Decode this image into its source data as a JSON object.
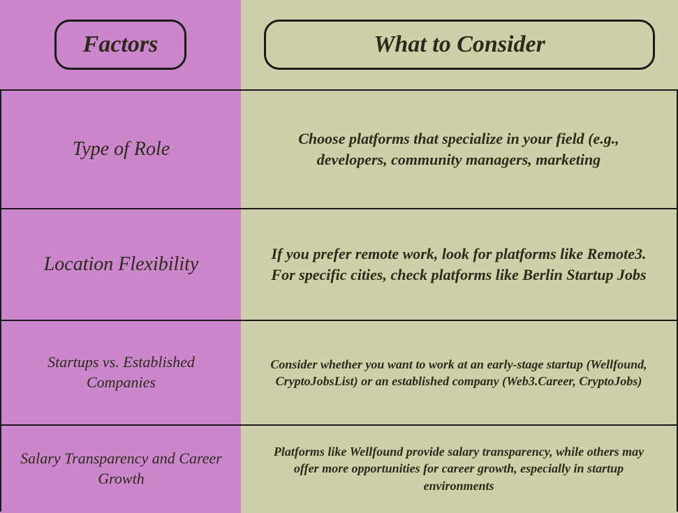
{
  "headers": {
    "factors": "Factors",
    "consider": "What to Consider"
  },
  "rows": [
    {
      "factor": "Type of Role",
      "consider": "Choose platforms that specialize in your field (e.g., developers, community managers, marketing"
    },
    {
      "factor": "Location Flexibility",
      "consider": "If you prefer remote work, look for platforms like Remote3. For specific cities, check platforms like Berlin Startup Jobs"
    },
    {
      "factor": "Startups vs. Established Companies",
      "consider": "Consider whether you want to work at an early-stage startup (Wellfound, CryptoJobsList) or an established company (Web3.Career, CryptoJobs)"
    },
    {
      "factor": "Salary Transparency and Career Growth",
      "consider": "Platforms like Wellfound provide salary transparency, while others may offer more opportunities for career growth, especially in startup environments"
    }
  ],
  "chart_data": {
    "type": "table",
    "columns": [
      "Factors",
      "What to Consider"
    ],
    "rows": [
      [
        "Type of Role",
        "Choose platforms that specialize in your field (e.g., developers, community managers, marketing"
      ],
      [
        "Location Flexibility",
        "If you prefer remote work, look for platforms like Remote3. For specific cities, check platforms like Berlin Startup Jobs"
      ],
      [
        "Startups vs. Established Companies",
        "Consider whether you want to work at an early-stage startup (Wellfound, CryptoJobsList) or an established company (Web3.Career, CryptoJobs)"
      ],
      [
        "Salary Transparency and Career Growth",
        "Platforms like Wellfound provide salary transparency, while others may offer more opportunities for career growth, especially in startup environments"
      ]
    ]
  }
}
